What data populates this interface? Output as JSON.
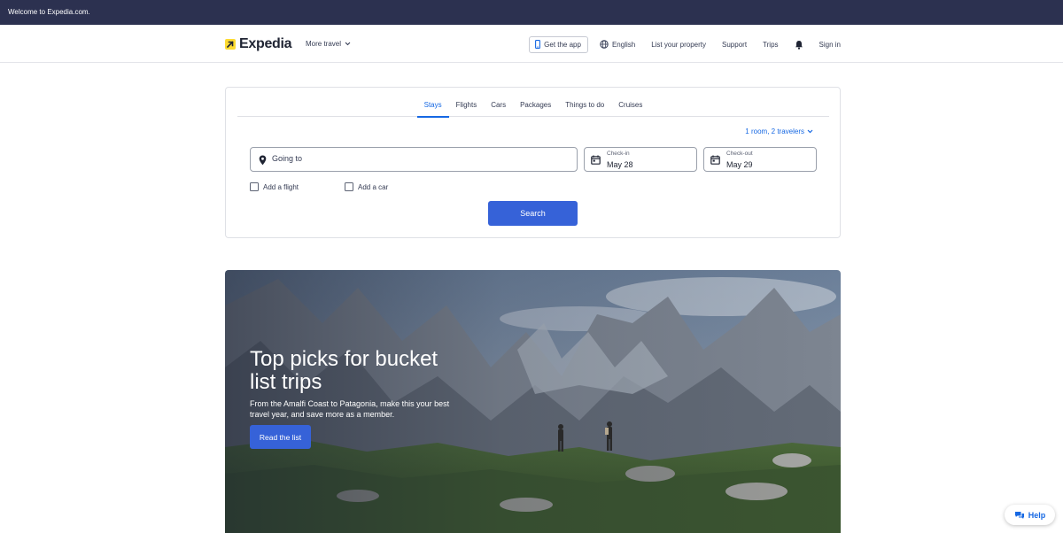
{
  "topbar": {
    "welcome": "Welcome to Expedia.com."
  },
  "header": {
    "logo_text": "Expedia",
    "more_travel": "More travel",
    "get_app": "Get the app",
    "language": "English",
    "list_property": "List your property",
    "support": "Support",
    "trips": "Trips",
    "sign_in": "Sign in"
  },
  "search": {
    "tabs": [
      {
        "label": "Stays",
        "active": true
      },
      {
        "label": "Flights"
      },
      {
        "label": "Cars"
      },
      {
        "label": "Packages"
      },
      {
        "label": "Things to do"
      },
      {
        "label": "Cruises"
      }
    ],
    "travelers": "1 room, 2 travelers",
    "going_to_placeholder": "Going to",
    "checkin_label": "Check-in",
    "checkin_value": "May 28",
    "checkout_label": "Check-out",
    "checkout_value": "May 29",
    "add_flight": "Add a flight",
    "add_car": "Add a car",
    "search_button": "Search"
  },
  "hero": {
    "title": "Top picks for bucket list trips",
    "subtitle": "From the Amalfi Coast to Patagonia, make this your best travel year, and save more as a member.",
    "button": "Read the list"
  },
  "help": {
    "label": "Help"
  },
  "colors": {
    "topbar": "#2c3150",
    "accent": "#1668e3",
    "button": "#3662d8",
    "logo_yellow": "#fddb32"
  }
}
